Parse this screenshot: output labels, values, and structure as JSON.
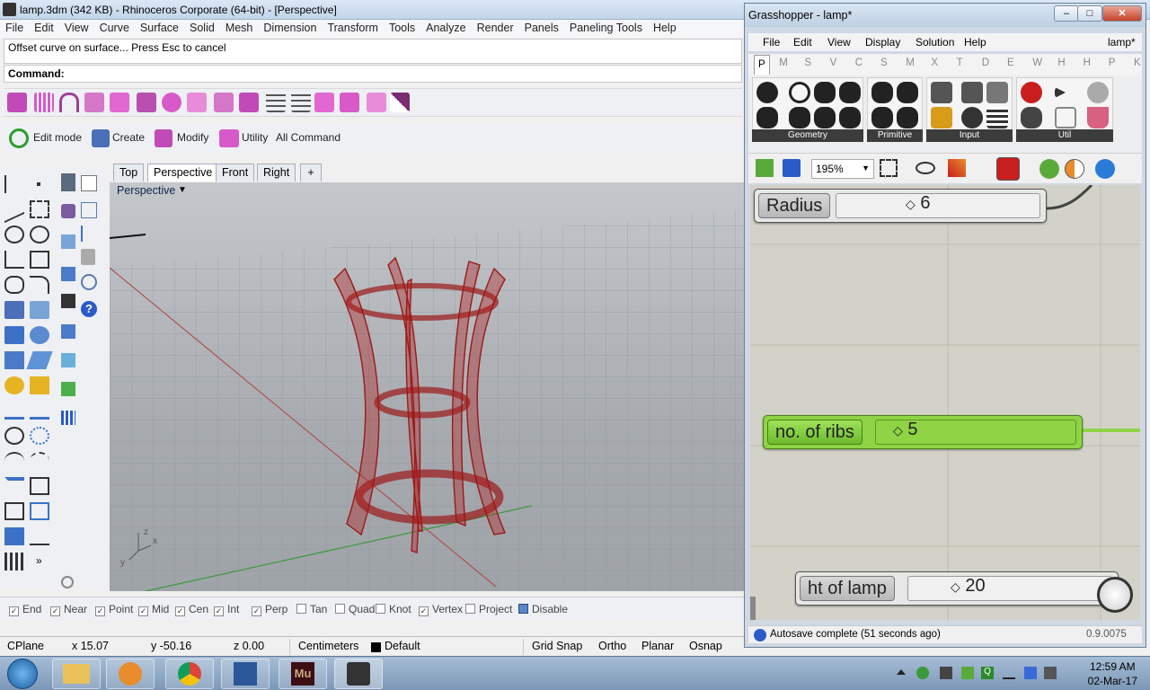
{
  "rhino": {
    "title": "lamp.3dm (342 KB) - Rhinoceros Corporate (64-bit) - [Perspective]",
    "menu": [
      "File",
      "Edit",
      "View",
      "Curve",
      "Surface",
      "Solid",
      "Mesh",
      "Dimension",
      "Transform",
      "Tools",
      "Analyze",
      "Render",
      "Panels",
      "Paneling Tools",
      "Help"
    ],
    "command_history": "Offset curve on surface... Press Esc to cancel",
    "command_prompt": "Command:",
    "toolbar2": {
      "edit_mode": "Edit mode",
      "create": "Create",
      "modify": "Modify",
      "utility": "Utility",
      "all_command": "All Command"
    },
    "viewport_tabs": [
      "Top",
      "Perspective",
      "Front",
      "Right"
    ],
    "viewport_label": "Perspective",
    "axis_labels": {
      "z": "z",
      "x": "x",
      "y": "y"
    },
    "osnaps": [
      {
        "label": "End",
        "checked": true
      },
      {
        "label": "Near",
        "checked": true
      },
      {
        "label": "Point",
        "checked": true
      },
      {
        "label": "Mid",
        "checked": true
      },
      {
        "label": "Cen",
        "checked": true
      },
      {
        "label": "Int",
        "checked": true
      },
      {
        "label": "Perp",
        "checked": true
      },
      {
        "label": "Tan",
        "checked": false
      },
      {
        "label": "Quad",
        "checked": false
      },
      {
        "label": "Knot",
        "checked": false
      },
      {
        "label": "Vertex",
        "checked": true
      },
      {
        "label": "Project",
        "checked": false
      },
      {
        "label": "Disable",
        "checked": false
      }
    ],
    "status": {
      "cplane": "CPlane",
      "x": "x 15.07",
      "y": "y -50.16",
      "z": "z 0.00",
      "units": "Centimeters",
      "layer": "Default",
      "grid_snap": "Grid Snap",
      "ortho": "Ortho",
      "planar": "Planar",
      "osnap": "Osnap"
    }
  },
  "grasshopper": {
    "title": "Grasshopper - lamp*",
    "menu": [
      "File",
      "Edit",
      "View",
      "Display",
      "Solution",
      "Help"
    ],
    "doc_name": "lamp*",
    "tabs": [
      "P",
      "M",
      "S",
      "V",
      "C",
      "S",
      "M",
      "X",
      "T",
      "D",
      "E",
      "W",
      "H",
      "H",
      "P",
      "K"
    ],
    "ribbon_groups": [
      "Geometry",
      "Primitive",
      "Input",
      "Util"
    ],
    "zoom": "195%",
    "sliders": [
      {
        "label": "Radius",
        "value": "6",
        "color": "grey"
      },
      {
        "label": "no. of ribs",
        "value": "5",
        "color": "green"
      },
      {
        "label": "ht of lamp",
        "value": "20",
        "color": "grey"
      }
    ],
    "status": "Autosave complete (51 seconds ago)",
    "version": "0.9.0075"
  },
  "taskbar": {
    "time": "12:59 AM",
    "date": "02-Mar-17"
  },
  "colors": {
    "lamp": "#b01c1c",
    "gh_green": "#8ed444"
  }
}
